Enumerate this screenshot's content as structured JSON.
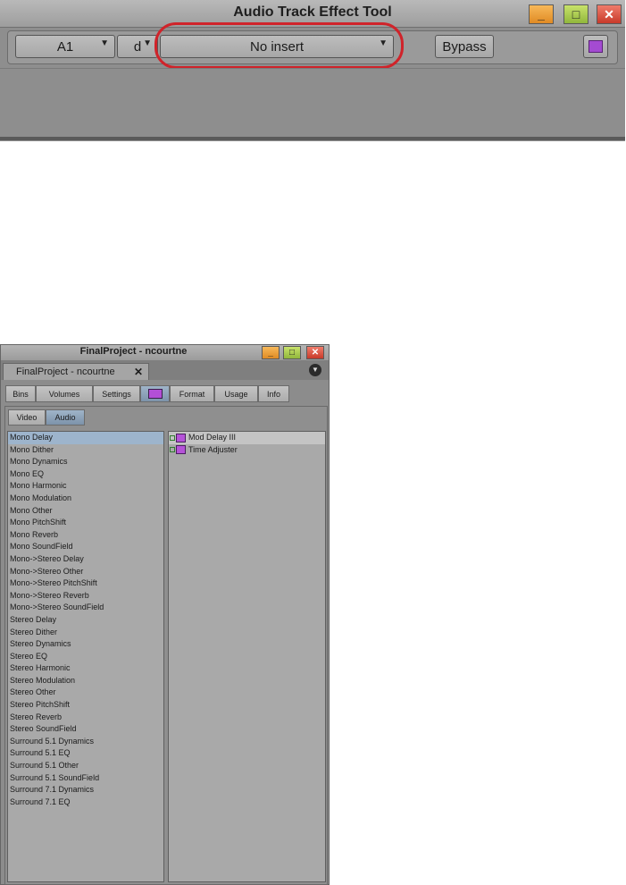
{
  "audio_tool": {
    "title": "Audio Track Effect Tool",
    "track": "A1",
    "d_label": "d",
    "insert": "No insert",
    "bypass": "Bypass"
  },
  "project": {
    "title": "FinalProject - ncourtne",
    "doc_tab": "FinalProject - ncourtne",
    "tabs": [
      "Bins",
      "Volumes",
      "Settings",
      "",
      "Format",
      "Usage",
      "Info"
    ],
    "video_tab": "Video",
    "audio_tab": "Audio",
    "categories": [
      "Mono Delay",
      "Mono Dither",
      "Mono Dynamics",
      "Mono EQ",
      "Mono Harmonic",
      "Mono Modulation",
      "Mono Other",
      "Mono PitchShift",
      "Mono Reverb",
      "Mono SoundField",
      "Mono->Stereo Delay",
      "Mono->Stereo Other",
      "Mono->Stereo PitchShift",
      "Mono->Stereo Reverb",
      "Mono->Stereo SoundField",
      "Stereo Delay",
      "Stereo Dither",
      "Stereo Dynamics",
      "Stereo EQ",
      "Stereo Harmonic",
      "Stereo Modulation",
      "Stereo Other",
      "Stereo PitchShift",
      "Stereo Reverb",
      "Stereo SoundField",
      "Surround 5.1 Dynamics",
      "Surround 5.1 EQ",
      "Surround 5.1 Other",
      "Surround 5.1 SoundField",
      "Surround 7.1 Dynamics",
      "Surround 7.1 EQ"
    ],
    "effects": [
      "Mod Delay III",
      "Time Adjuster"
    ]
  }
}
